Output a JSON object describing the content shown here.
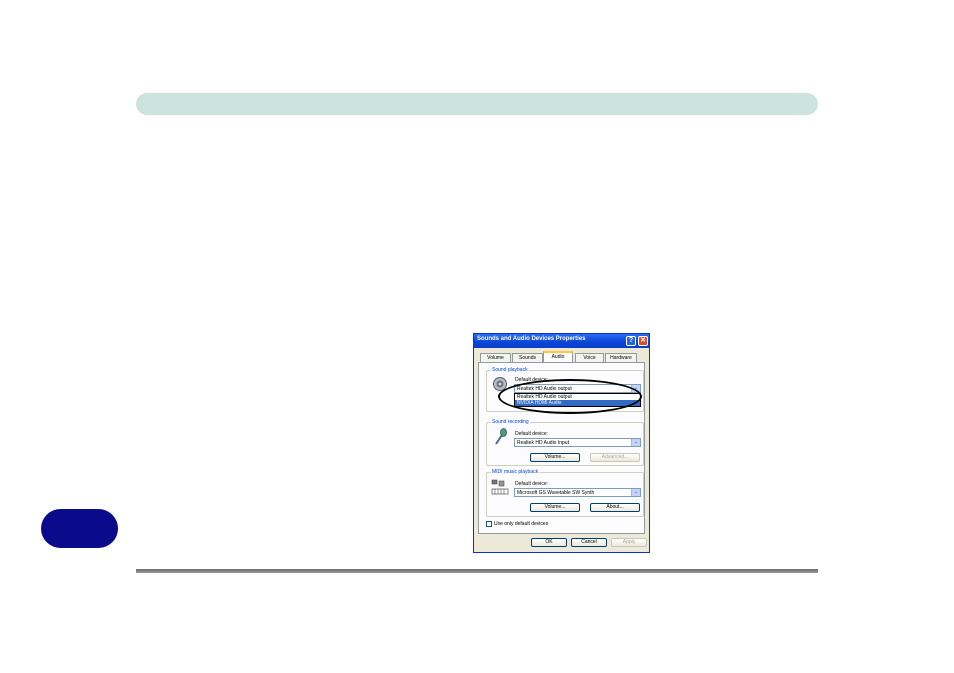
{
  "dialog": {
    "title": "Sounds and Audio Devices Properties",
    "help_glyph": "?",
    "close_glyph": "✕",
    "tabs": [
      {
        "label": "Volume"
      },
      {
        "label": "Sounds"
      },
      {
        "label": "Audio"
      },
      {
        "label": "Voice"
      },
      {
        "label": "Hardware"
      }
    ],
    "active_tab": "Audio",
    "sound_playback": {
      "title": "Sound playback",
      "device_label": "Default device:",
      "selected": "Realtek HD Audio output",
      "options": [
        "Realtek HD Audio output",
        "NVIDIA HDMI Audio"
      ],
      "highlighted_option": "NVIDIA HDMI Audio",
      "icon": "speaker-icon"
    },
    "sound_recording": {
      "title": "Sound recording",
      "device_label": "Default device:",
      "selected": "Realtek HD Audio Input",
      "volume_button": "Volume...",
      "advanced_button": "Advanced...",
      "icon": "microphone-icon"
    },
    "midi_playback": {
      "title": "MIDI music playback",
      "device_label": "Default device:",
      "selected": "Microsoft GS Wavetable SW Synth",
      "volume_button": "Volume...",
      "about_button": "About...",
      "icon": "midi-keyboard-icon"
    },
    "use_only_default": "Use only default devices",
    "ok": "OK",
    "cancel": "Cancel",
    "apply": "Apply",
    "dropdown_glyph": "⌄"
  },
  "colors": {
    "header_bar": "#cde3dd",
    "side_tab": "#0a0a8c",
    "titlebar": "#0a45d8",
    "selection": "#316ac5"
  }
}
